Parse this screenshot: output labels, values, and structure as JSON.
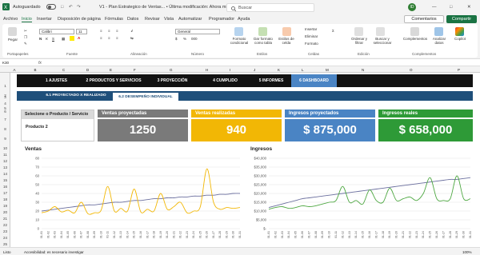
{
  "titlebar": {
    "autosave_label": "Autoguardado",
    "doc_title": "V1 - Plan Estrategico de Ventas... • Última modificación: Ahora mismo",
    "search_placeholder": "Buscar"
  },
  "menus": [
    "Archivo",
    "Inicio",
    "Insertar",
    "Disposición de página",
    "Fórmulas",
    "Datos",
    "Revisar",
    "Vista",
    "Automatizar",
    "Programador",
    "Ayuda"
  ],
  "active_menu": "Inicio",
  "header_buttons": {
    "comments": "Comentarios",
    "share": "Compartir"
  },
  "ribbon": {
    "paste": "Pegar",
    "font_name": "Calibri",
    "font_size": "11",
    "number_format": "General",
    "conditional_format": "Formato condicional",
    "format_as_table": "Dar formato como tabla",
    "cell_styles": "Estilos de celda",
    "insert": "Insertar",
    "delete": "Eliminar",
    "format": "Formato",
    "sort_filter": "Ordenar y filtrar",
    "find_select": "Buscar y seleccionar",
    "addins": "Complementos",
    "analyze": "Analizar datos",
    "copilot": "Copilot",
    "groups": [
      "Portapapeles",
      "Fuente",
      "Alineación",
      "Número",
      "Estilos",
      "Celdas",
      "Edición",
      "Complementos"
    ]
  },
  "formula_bar": {
    "name_box": "K30",
    "fx": "fx"
  },
  "columns": [
    "A",
    "B",
    "C",
    "D",
    "E",
    "F",
    "G",
    "H",
    "I",
    "J",
    "K",
    "L",
    "M",
    "N",
    "O",
    "P"
  ],
  "rows": [
    "1",
    "2",
    "3",
    "4",
    "5",
    "6",
    "7",
    "8",
    "9",
    "10",
    "11",
    "12",
    "13",
    "14",
    "15",
    "16",
    "17",
    "18",
    "19",
    "20",
    "21",
    "22",
    "23",
    "24",
    "25"
  ],
  "nav": {
    "items": [
      "1 AJUSTES",
      "2 PRODUCTOS Y SERVICIOS",
      "3 PROYECCIÓN",
      "4 CUMPLIDO",
      "5 INFORMES",
      "6 DASHBOARD"
    ],
    "active": "6 DASHBOARD"
  },
  "subnav": {
    "items": [
      "6.1 PROYECTADO X REALIZADO",
      "6.2 DESEMPEÑO INDIVIDUAL"
    ],
    "active": "6.2 DESEMPEÑO INDIVIDUAL"
  },
  "selector": {
    "label": "Selecione o Producto / Servicio",
    "value": "Producto 2"
  },
  "cards": [
    {
      "title": "Ventas proyectadas",
      "value": "1250",
      "color": "#7a7a7a"
    },
    {
      "title": "Ventas realizadas",
      "value": "940",
      "color": "#f2b705"
    },
    {
      "title": "Ingresos proyectados",
      "value": "$ 875,000",
      "color": "#4a84c4"
    },
    {
      "title": "Ingresos reales",
      "value": "$ 658,000",
      "color": "#2e9a37"
    }
  ],
  "status": {
    "ready": "Listo",
    "accessibility": "Accesibilidad: es necesario investigar",
    "zoom": "100%"
  },
  "chart_data": [
    {
      "type": "line",
      "title": "Ventas",
      "x": [
        "01-01",
        "01-02",
        "01-03",
        "01-04",
        "01-05",
        "01-06",
        "01-07",
        "01-08",
        "01-09",
        "01-10",
        "01-11",
        "01-12",
        "01-13",
        "01-14",
        "01-15",
        "01-16",
        "01-17",
        "01-18",
        "01-19",
        "01-20",
        "01-21",
        "01-22",
        "01-23",
        "01-24",
        "01-25",
        "01-26",
        "01-27",
        "01-28",
        "01-29",
        "01-30",
        "01-31"
      ],
      "ylim": [
        0,
        80
      ],
      "yticks": [
        0,
        10,
        20,
        30,
        40,
        50,
        60,
        70,
        80
      ],
      "series": [
        {
          "color": "#6b6f9e",
          "values": [
            20,
            21,
            22,
            23,
            24,
            25,
            26,
            27,
            27,
            28,
            29,
            30,
            30,
            31,
            32,
            32,
            33,
            34,
            34,
            35,
            35,
            36,
            36,
            37,
            37,
            38,
            38,
            39,
            39,
            40,
            40
          ]
        },
        {
          "color": "#f2b705",
          "values": [
            18,
            20,
            25,
            19,
            21,
            18,
            30,
            17,
            18,
            21,
            48,
            20,
            23,
            20,
            45,
            19,
            22,
            20,
            40,
            22,
            25,
            30,
            18,
            20,
            25,
            68,
            30,
            22,
            24,
            23,
            24
          ]
        }
      ]
    },
    {
      "type": "line",
      "title": "Ingresos",
      "x": [
        "01-01",
        "01-02",
        "01-03",
        "01-04",
        "01-05",
        "01-06",
        "01-07",
        "01-08",
        "01-09",
        "01-10",
        "01-11",
        "01-12",
        "01-13",
        "01-14",
        "01-15",
        "01-16",
        "01-17",
        "01-18",
        "01-19",
        "01-20",
        "01-21",
        "01-22",
        "01-23",
        "01-24",
        "01-25",
        "01-26",
        "01-27",
        "01-28",
        "01-29",
        "01-30",
        "01-31"
      ],
      "ylim": [
        0,
        40000
      ],
      "yticks": [
        0,
        5000,
        10000,
        15000,
        20000,
        25000,
        30000,
        35000,
        40000
      ],
      "ytick_labels": [
        "$-",
        "$5,000",
        "$10,000",
        "$15,000",
        "$20,000",
        "$25,000",
        "$30,000",
        "$35,000",
        "$40,000"
      ],
      "series": [
        {
          "color": "#6b6f9e",
          "values": [
            12000,
            13000,
            14000,
            15000,
            16000,
            17000,
            17500,
            18000,
            18500,
            19000,
            19500,
            20000,
            20500,
            21000,
            21500,
            22000,
            22500,
            23000,
            23500,
            24000,
            24500,
            25000,
            25500,
            26000,
            26500,
            27000,
            27500,
            28000,
            28000,
            28500,
            29000
          ]
        },
        {
          "color": "#4fa843",
          "values": [
            11000,
            12000,
            12500,
            11500,
            12000,
            13000,
            12500,
            13000,
            14000,
            15000,
            16000,
            24000,
            15000,
            16000,
            14000,
            22000,
            16000,
            15000,
            23000,
            16000,
            17000,
            18000,
            16000,
            20000,
            29000,
            17000,
            16000,
            17000,
            30000,
            17000,
            17000
          ]
        }
      ]
    }
  ]
}
